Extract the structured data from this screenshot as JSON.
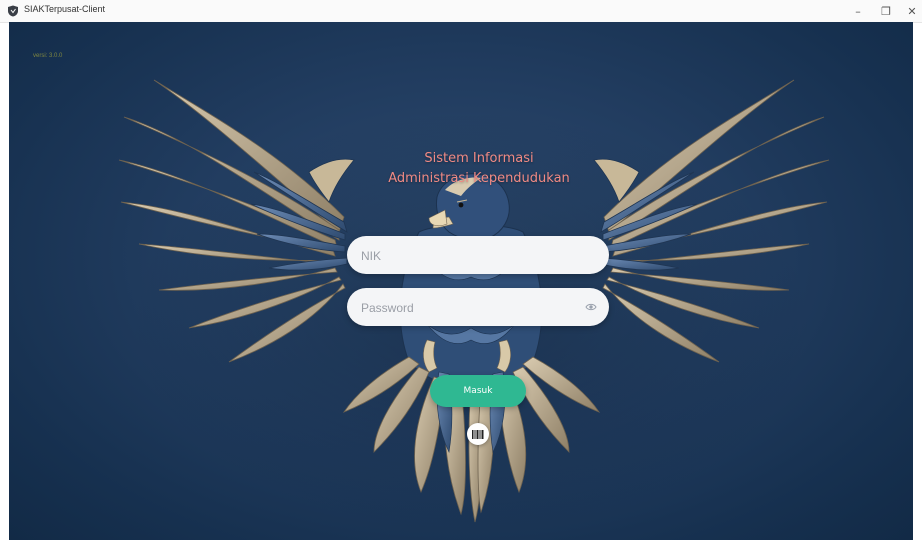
{
  "window": {
    "title": "SIAKTerpusat-Client",
    "controls": {
      "minimize": "–",
      "maximize": "❐",
      "close": "✕"
    }
  },
  "app": {
    "version": "versi: 3.0.0",
    "heading_line1": "Sistem Informasi",
    "heading_line2": "Administrasi Kependudukan",
    "nik": {
      "placeholder": "NIK",
      "value": ""
    },
    "password": {
      "placeholder": "Password",
      "value": ""
    },
    "login_label": "Masuk",
    "icons": {
      "password_toggle": "eye-icon",
      "scan": "barcode-icon",
      "app": "shield-icon"
    }
  },
  "colors": {
    "background": "#213c5f",
    "heading": "#f08a84",
    "login_button": "#2fb892",
    "field": "#f4f5f7"
  }
}
